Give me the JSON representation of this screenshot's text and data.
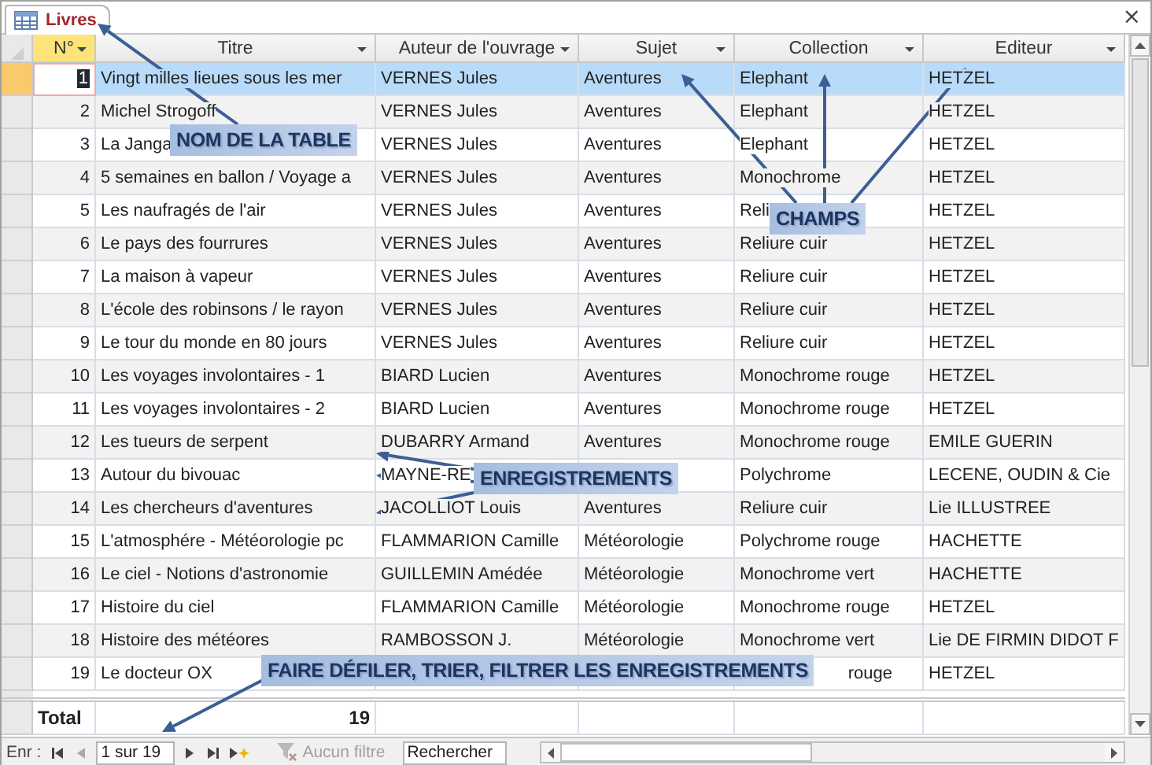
{
  "tab": {
    "title": "Livres",
    "close": "×"
  },
  "columns": [
    {
      "label": "N°",
      "selected": true
    },
    {
      "label": "Titre",
      "selected": false
    },
    {
      "label": "Auteur de l'ouvrage",
      "selected": false
    },
    {
      "label": "Sujet",
      "selected": false
    },
    {
      "label": "Collection",
      "selected": false
    },
    {
      "label": "Editeur",
      "selected": false
    }
  ],
  "rows": [
    {
      "selected": true,
      "n": "1",
      "title": "Vingt milles lieues sous les mer",
      "author": "VERNES Jules",
      "subject": "Aventures",
      "collection": "Elephant",
      "publisher": "HETZEL"
    },
    {
      "selected": false,
      "n": "2",
      "title": "Michel Strogoff",
      "author": "VERNES Jules",
      "subject": "Aventures",
      "collection": "Elephant",
      "publisher": "HETZEL"
    },
    {
      "selected": false,
      "n": "3",
      "title": "La Janga",
      "author": "VERNES Jules",
      "subject": "Aventures",
      "collection": "Elephant",
      "publisher": "HETZEL"
    },
    {
      "selected": false,
      "n": "4",
      "title": "5 semaines en ballon / Voyage a",
      "author": "VERNES Jules",
      "subject": "Aventures",
      "collection": "Monochrome",
      "publisher": "HETZEL"
    },
    {
      "selected": false,
      "n": "5",
      "title": "Les naufragés de l'air",
      "author": "VERNES Jules",
      "subject": "Aventures",
      "collection": "Reli",
      "publisher": "HETZEL"
    },
    {
      "selected": false,
      "n": "6",
      "title": "Le pays des fourrures",
      "author": "VERNES Jules",
      "subject": "Aventures",
      "collection": "Reliure cuir",
      "publisher": "HETZEL"
    },
    {
      "selected": false,
      "n": "7",
      "title": "La maison à vapeur",
      "author": "VERNES Jules",
      "subject": "Aventures",
      "collection": "Reliure cuir",
      "publisher": "HETZEL"
    },
    {
      "selected": false,
      "n": "8",
      "title": "L'école des robinsons / le rayon",
      "author": "VERNES Jules",
      "subject": "Aventures",
      "collection": "Reliure cuir",
      "publisher": "HETZEL"
    },
    {
      "selected": false,
      "n": "9",
      "title": "Le tour du monde en 80 jours",
      "author": "VERNES Jules",
      "subject": "Aventures",
      "collection": "Reliure cuir",
      "publisher": "HETZEL"
    },
    {
      "selected": false,
      "n": "10",
      "title": "Les voyages involontaires - 1",
      "author": "BIARD Lucien",
      "subject": "Aventures",
      "collection": "Monochrome rouge",
      "publisher": "HETZEL"
    },
    {
      "selected": false,
      "n": "11",
      "title": "Les voyages involontaires - 2",
      "author": "BIARD Lucien",
      "subject": "Aventures",
      "collection": "Monochrome rouge",
      "publisher": "HETZEL"
    },
    {
      "selected": false,
      "n": "12",
      "title": "Les tueurs de serpent",
      "author": "DUBARRY Armand",
      "subject": "Aventures",
      "collection": "Monochrome rouge",
      "publisher": "EMILE GUERIN"
    },
    {
      "selected": false,
      "n": "13",
      "title": "Autour du bivouac",
      "author": "MAYNE-RE",
      "collection": "Polychrome",
      "publisher": "LECENE, OUDIN & Cie"
    },
    {
      "selected": false,
      "n": "14",
      "title": "Les chercheurs d'aventures",
      "author": "JACOLLIOT Louis",
      "subject": "Aventures",
      "collection": "Reliure cuir",
      "publisher": "Lie ILLUSTREE"
    },
    {
      "selected": false,
      "n": "15",
      "title": "L'atmosphére - Météorologie pc",
      "author": "FLAMMARION Camille",
      "subject": "Météorologie",
      "collection": "Polychrome rouge",
      "publisher": "HACHETTE"
    },
    {
      "selected": false,
      "n": "16",
      "title": "Le ciel - Notions d'astronomie",
      "author": "GUILLEMIN Amédée",
      "subject": "Météorologie",
      "collection": "Monochrome vert",
      "publisher": "HACHETTE"
    },
    {
      "selected": false,
      "n": "17",
      "title": "Histoire du ciel",
      "author": "FLAMMARION Camille",
      "subject": "Météorologie",
      "collection": "Monochrome rouge",
      "publisher": "HETZEL"
    },
    {
      "selected": false,
      "n": "18",
      "title": "Histoire des météores",
      "author": "RAMBOSSON J.",
      "subject": "Météorologie",
      "collection": "Monochrome vert",
      "publisher": "Lie DE FIRMIN DIDOT F"
    },
    {
      "selected": false,
      "n": "19",
      "title": "Le docteur OX",
      "collection_end": "rouge",
      "publisher": "HETZEL"
    }
  ],
  "total": {
    "label": "Total",
    "value": "19"
  },
  "nav": {
    "label": "Enr :",
    "position": "1 sur 19",
    "filter": "Aucun filtre",
    "filter_disabled": true,
    "search_placeholder": "Rechercher"
  },
  "callouts": [
    {
      "text": "NOM DE LA TABLE"
    },
    {
      "text": "CHAMPS"
    },
    {
      "text": "ENREGISTREMENTS"
    },
    {
      "text": "FAIRE DÉFILER, TRIER, FILTRER LES ENREGISTREMENTS"
    }
  ]
}
